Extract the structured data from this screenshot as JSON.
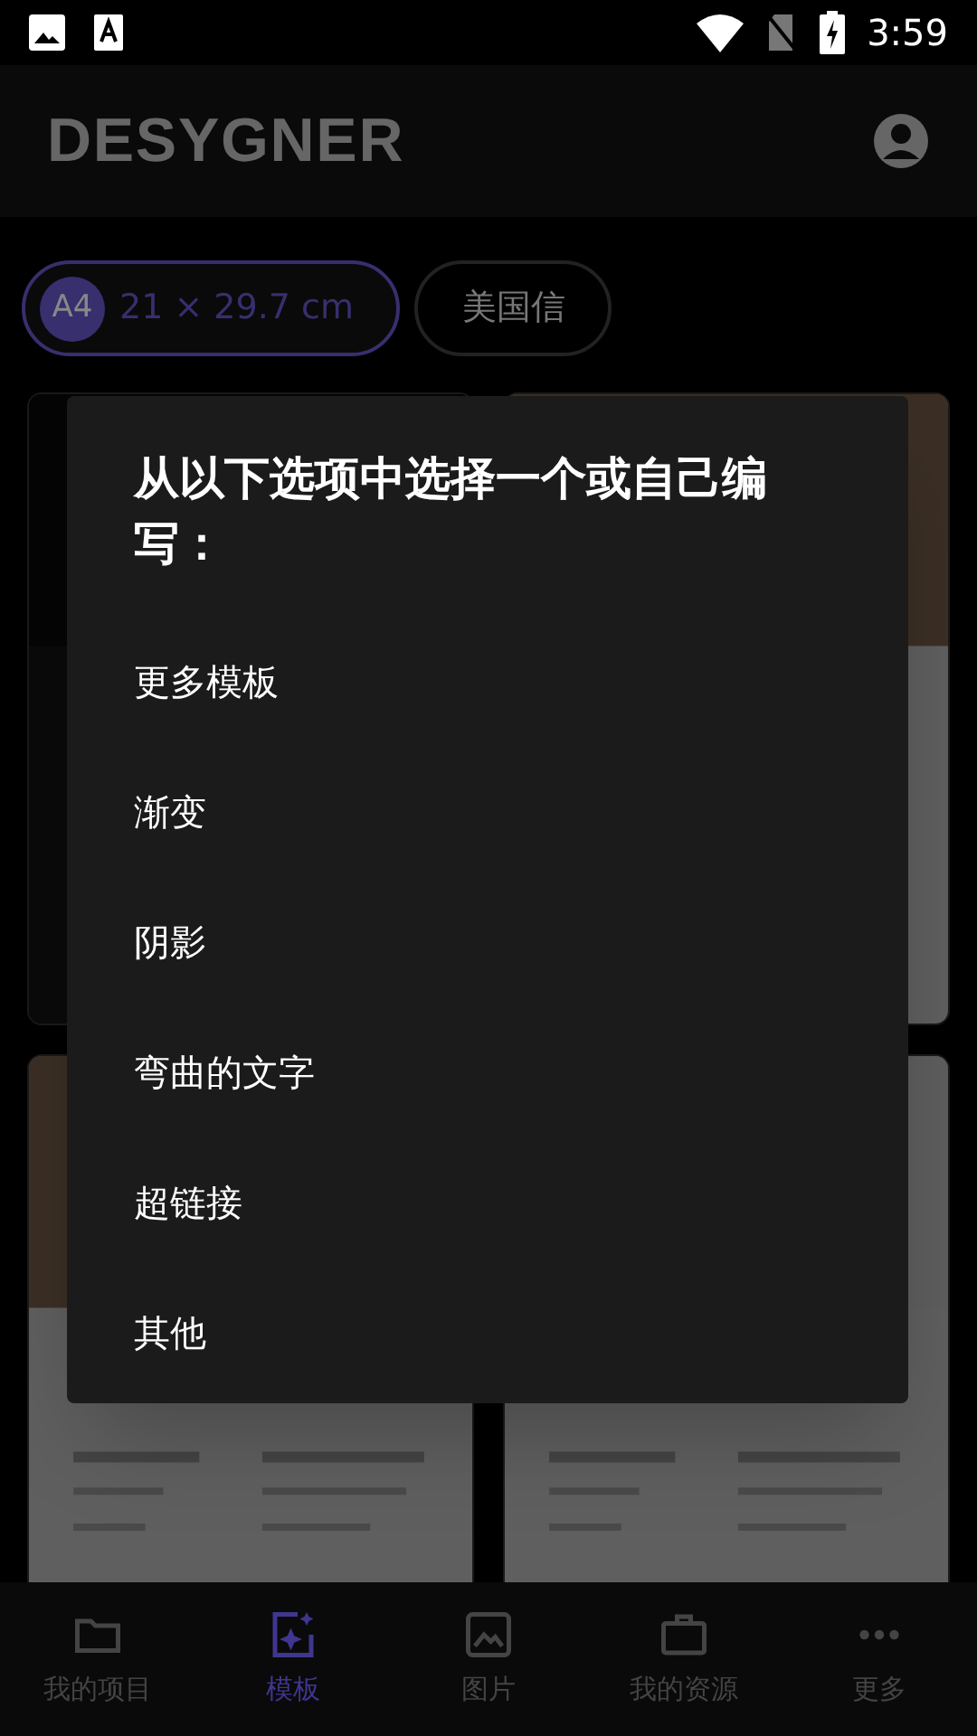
{
  "status_bar": {
    "time": "3:59"
  },
  "app_bar": {
    "title": "DESYGNER"
  },
  "size_chips": [
    {
      "badge": "A4",
      "label": "21 × 29.7 cm",
      "selected": true
    },
    {
      "label": "美国信",
      "selected": false
    }
  ],
  "dialog": {
    "title": "从以下选项中选择一个或自己编写：",
    "options": [
      "更多模板",
      "渐变",
      "阴影",
      "弯曲的文字",
      "超链接",
      "其他"
    ]
  },
  "bottom_nav": [
    {
      "label": "我的项目",
      "selected": false
    },
    {
      "label": "模板",
      "selected": true
    },
    {
      "label": "图片",
      "selected": false
    },
    {
      "label": "我的资源",
      "selected": false
    },
    {
      "label": "更多",
      "selected": false
    }
  ]
}
